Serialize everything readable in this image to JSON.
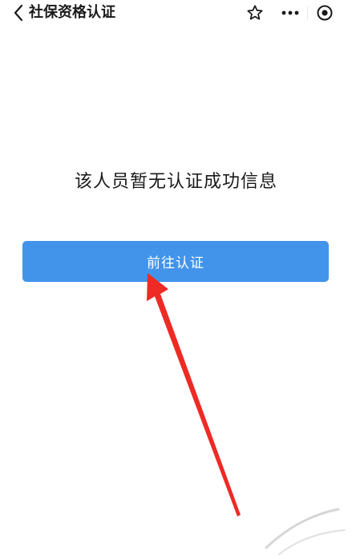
{
  "header": {
    "title": "社保资格认证",
    "back_icon": "chevron-left-icon",
    "star_icon": "star-outline-icon",
    "more_icon": "ellipsis-icon",
    "close_icon": "target-circle-icon"
  },
  "main": {
    "message": "该人员暂无认证成功信息",
    "button_label": "前往认证"
  },
  "colors": {
    "primary_button": "#4294ea",
    "arrow": "#ee2a24",
    "text": "#1a1a1a"
  }
}
